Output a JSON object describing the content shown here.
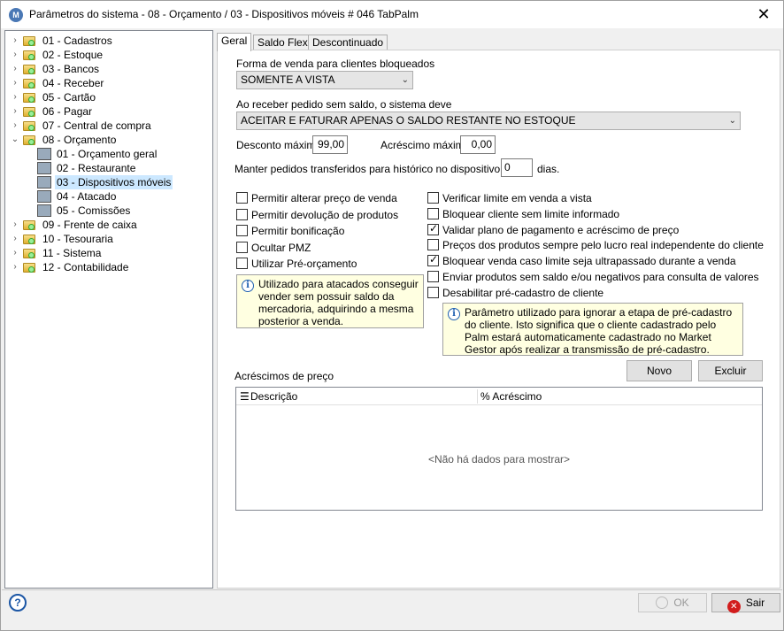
{
  "window": {
    "title": "Parâmetros do sistema - 08 - Orçamento / 03 - Dispositivos móveis # 046 TabPalm"
  },
  "tree": [
    {
      "label": "01 - Cadastros",
      "icon": "folder-icon",
      "expander": "›"
    },
    {
      "label": "02 - Estoque",
      "icon": "folder-icon",
      "expander": "›"
    },
    {
      "label": "03 - Bancos",
      "icon": "folder-icon",
      "expander": "›"
    },
    {
      "label": "04 - Receber",
      "icon": "folder-icon",
      "expander": "›"
    },
    {
      "label": "05 - Cartão",
      "icon": "folder-icon",
      "expander": "›"
    },
    {
      "label": "06 - Pagar",
      "icon": "folder-icon",
      "expander": "›"
    },
    {
      "label": "07 - Central de compra",
      "icon": "folder-icon",
      "expander": "›"
    },
    {
      "label": "08 - Orçamento",
      "icon": "folder-open-icon",
      "expander": "⌄"
    },
    {
      "label": "01 - Orçamento geral",
      "icon": "monitor-icon",
      "expander": ""
    },
    {
      "label": "02 - Restaurante",
      "icon": "cutlery-icon",
      "expander": ""
    },
    {
      "label": "03 - Dispositivos móveis",
      "icon": "mobile-icon",
      "expander": ""
    },
    {
      "label": "04 - Atacado",
      "icon": "warehouse-icon",
      "expander": ""
    },
    {
      "label": "05 - Comissões",
      "icon": "commission-icon",
      "expander": ""
    },
    {
      "label": "09 - Frente de caixa",
      "icon": "folder-icon",
      "expander": "›"
    },
    {
      "label": "10 - Tesouraria",
      "icon": "folder-icon",
      "expander": "›"
    },
    {
      "label": "11 - Sistema",
      "icon": "folder-icon",
      "expander": "›"
    },
    {
      "label": "12 - Contabilidade",
      "icon": "folder-icon",
      "expander": "›"
    }
  ],
  "tabs": [
    "Geral",
    "Saldo Flex",
    "Descontinuado"
  ],
  "form": {
    "forma_label": "Forma de venda para clientes bloqueados",
    "forma_value": "SOMENTE A VISTA",
    "receber_label": "Ao receber pedido sem saldo, o sistema deve",
    "receber_value": "ACEITAR E FATURAR APENAS O SALDO RESTANTE NO ESTOQUE",
    "desconto_label": "Desconto máximo",
    "desconto_value": "99,00",
    "acrescimo_label": "Acréscimo máximo",
    "acrescimo_value": "0,00",
    "manter_label": "Manter pedidos transferidos para histórico no dispositivo móvel",
    "manter_value": "0",
    "manter_suffix": "dias."
  },
  "checkboxes_left": [
    {
      "label": "Permitir alterar preço de venda",
      "checked": false
    },
    {
      "label": "Permitir devolução de produtos",
      "checked": false
    },
    {
      "label": "Permitir bonificação",
      "checked": false
    },
    {
      "label": "Ocultar PMZ",
      "checked": false
    },
    {
      "label": "Utilizar Pré-orçamento",
      "checked": false
    }
  ],
  "checkboxes_right": [
    {
      "label": "Verificar limite em venda a vista",
      "checked": false
    },
    {
      "label": "Bloquear cliente sem limite informado",
      "checked": false
    },
    {
      "label": "Validar plano de pagamento e acréscimo de preço",
      "checked": true
    },
    {
      "label": "Preços dos produtos sempre pelo lucro real independente do cliente",
      "checked": false
    },
    {
      "label": "Bloquear venda caso limite seja ultrapassado durante a venda",
      "checked": true
    },
    {
      "label": "Enviar produtos sem saldo e/ou negativos para consulta de valores",
      "checked": false
    },
    {
      "label": "Desabilitar pré-cadastro de cliente",
      "checked": false
    }
  ],
  "hints": {
    "left": "Utilizado para atacados conseguir vender sem possuir saldo da mercadoria, adquirindo a mesma posterior a venda.",
    "right": "Parâmetro utilizado para ignorar a etapa de pré-cadastro do cliente. Isto significa que o cliente cadastrado pelo Palm estará automaticamente cadastrado no Market Gestor após realizar a transmissão de pré-cadastro."
  },
  "acrescimos": {
    "label": "Acréscimos de preço",
    "novo": "Novo",
    "excluir": "Excluir",
    "col_descricao": "Descrição",
    "col_acrescimo": "% Acréscimo",
    "empty": "<Não há dados para mostrar>"
  },
  "footer": {
    "ok": "OK",
    "sair": "Sair"
  }
}
